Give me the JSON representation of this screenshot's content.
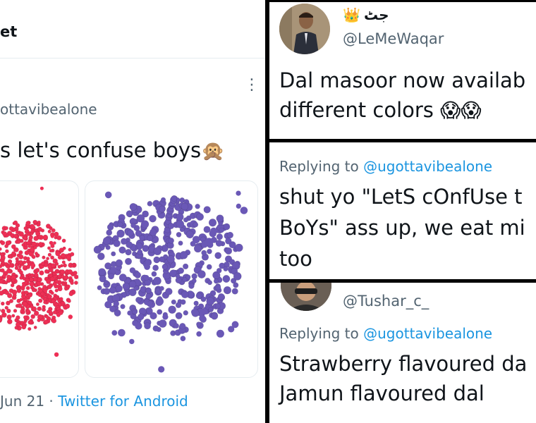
{
  "left": {
    "header_title": "et",
    "handle": "ottavibealone",
    "tweet_text": "s let's confuse boys",
    "tweet_emoji": "🙊",
    "date": "Jun 21",
    "separator": "·",
    "source": "Twitter for Android",
    "more_icon": "⋮"
  },
  "top_right": {
    "name_emoji": "👑",
    "display_name": "جٹ",
    "handle": "@LeMeWaqar",
    "text_line1": "Dal masoor now availab",
    "text_line2": "different colors",
    "text_emoji": "😱😱"
  },
  "mid_right": {
    "replying_prefix": "Replying to",
    "replying_handle": "@ugottavibealone",
    "text_line1": "shut yo \"LetS cOnfUse t",
    "text_line2": "BoYs\" ass up, we eat mi",
    "text_line3": "too"
  },
  "bottom_right": {
    "handle": "@Tushar_c_",
    "replying_prefix": "Replying to",
    "replying_handle": "@ugottavibealone",
    "text_line1": "Strawberry flavoured da",
    "text_line2": "Jamun flavoured dal"
  },
  "colors": {
    "link_blue": "#1b95e0",
    "lentil_pink": "#ee2f55",
    "lentil_purple": "#6a58b6"
  }
}
